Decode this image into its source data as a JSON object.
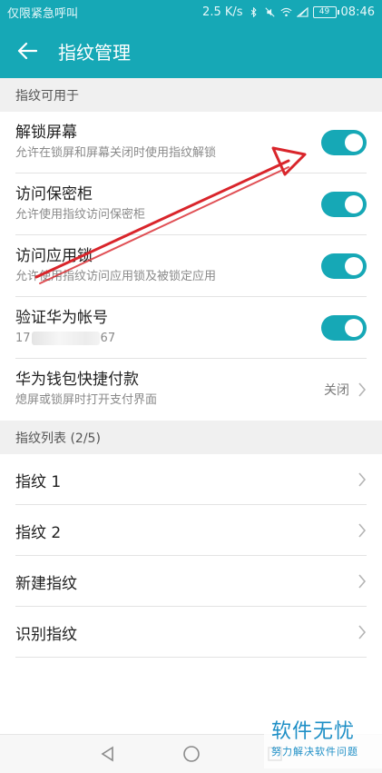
{
  "status_bar": {
    "left_text": "仅限紧急呼叫",
    "speed": "2.5 K/s",
    "battery": "49",
    "time": "08:46"
  },
  "app_bar": {
    "title": "指纹管理"
  },
  "section1": {
    "header": "指纹可用于",
    "items": [
      {
        "title": "解锁屏幕",
        "subtitle": "允许在锁屏和屏幕关闭时使用指纹解锁",
        "enabled": true
      },
      {
        "title": "访问保密柜",
        "subtitle": "允许使用指纹访问保密柜",
        "enabled": true
      },
      {
        "title": "访问应用锁",
        "subtitle": "允许使用指纹访问应用锁及被锁定应用",
        "enabled": true
      },
      {
        "title": "验证华为帐号",
        "subtitle_prefix": "17",
        "subtitle_suffix": "67",
        "enabled": true
      }
    ],
    "wallet": {
      "title": "华为钱包快捷付款",
      "subtitle": "熄屏或锁屏时打开支付界面",
      "value": "关闭"
    }
  },
  "section2": {
    "header": "指纹列表 (2/5)",
    "items": [
      "指纹 1",
      "指纹 2",
      "新建指纹",
      "识别指纹"
    ]
  },
  "watermark": {
    "title": "软件无忧",
    "subtitle": "努力解决软件问题"
  },
  "colors": {
    "accent": "#16a8b6",
    "arrow": "#d9252b"
  }
}
